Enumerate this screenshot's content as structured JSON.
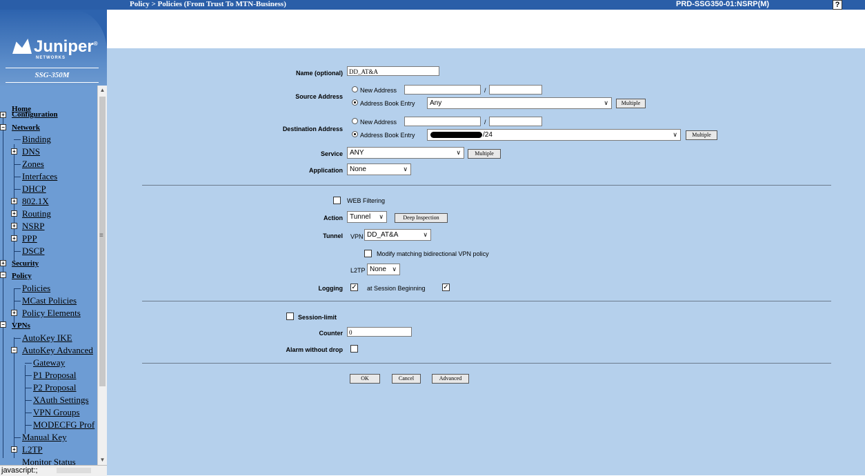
{
  "topbar": {
    "breadcrumb": "Policy > Policies (From Trust To MTN-Business)",
    "device": "PRD-SSG350-01:NSRP(M)",
    "help_glyph": "?"
  },
  "sidebar": {
    "logo_text": "Juniper",
    "logo_sub": "NETWORKS",
    "model": "SSG-350M",
    "nav": {
      "home": "Home",
      "configuration": "Configuration",
      "network": "Network",
      "binding": "Binding",
      "dns": "DNS",
      "zones": "Zones",
      "interfaces": "Interfaces",
      "dhcp": "DHCP",
      "dot1x": "802.1X",
      "routing": "Routing",
      "nsrp": "NSRP",
      "ppp": "PPP",
      "dscp": "DSCP",
      "security": "Security",
      "policy": "Policy",
      "policies": "Policies",
      "mcast_policies": "MCast Policies",
      "policy_elements": "Policy Elements",
      "vpns": "VPNs",
      "autokey_ike": "AutoKey IKE",
      "autokey_advanced": "AutoKey Advanced",
      "gateway": "Gateway",
      "p1_proposal": "P1 Proposal",
      "p2_proposal": "P2 Proposal",
      "xauth_settings": "XAuth Settings",
      "vpn_groups": "VPN Groups",
      "modecfg": "MODECFG Prof",
      "manual_key": "Manual Key",
      "l2tp": "L2TP",
      "monitor_status": "Monitor Status"
    },
    "status_text": "javascript:;",
    "scroll_glyph": "≡"
  },
  "form": {
    "name_label": "Name (optional)",
    "name_value": "DD_AT&A",
    "source_label": "Source Address",
    "new_address": "New Address",
    "slash": "/",
    "address_book_entry": "Address Book Entry",
    "source_value": "Any",
    "multiple": "Multiple",
    "destination_label": "Destination Address",
    "destination_value_suffix": "/24",
    "service_label": "Service",
    "service_value": "ANY",
    "application_label": "Application",
    "application_value": "None",
    "web_filtering": "WEB Filtering",
    "action_label": "Action",
    "action_value": "Tunnel",
    "deep_inspection": "Deep Inspection",
    "tunnel_label": "Tunnel",
    "vpn_prefix": "VPN",
    "vpn_value": "DD_AT&A",
    "modify_bidirectional": "Modify matching bidirectional VPN policy",
    "l2tp_prefix": "L2TP",
    "l2tp_value": "None",
    "logging_label": "Logging",
    "at_session_beginning": "at Session Beginning",
    "session_limit": "Session-limit",
    "counter_label": "Counter",
    "counter_value": "0",
    "alarm_without_drop": "Alarm without drop",
    "ok": "OK",
    "cancel": "Cancel",
    "advanced": "Advanced"
  }
}
